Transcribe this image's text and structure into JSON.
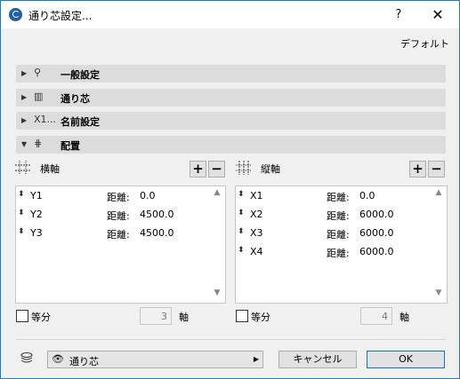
{
  "window": {
    "title": "通り芯設定...",
    "help": "?",
    "close": "✕"
  },
  "default_link": "デフォルト",
  "sections": [
    {
      "icon": "⚲",
      "label": "一般設定"
    },
    {
      "icon": "▥",
      "label": "通り芯"
    },
    {
      "icon": "X1...",
      "label": "名前設定"
    },
    {
      "icon": "⋕",
      "label": "配置"
    }
  ],
  "horizontal": {
    "label": "横軸",
    "rows": [
      {
        "name": "Y1",
        "label": "距離:",
        "value": "0.0"
      },
      {
        "name": "Y2",
        "label": "距離:",
        "value": "4500.0"
      },
      {
        "name": "Y3",
        "label": "距離:",
        "value": "4500.0"
      }
    ],
    "equal_label": "等分",
    "count": "3",
    "axis_label": "軸"
  },
  "vertical": {
    "label": "縦軸",
    "rows": [
      {
        "name": "X1",
        "label": "距離:",
        "value": "0.0"
      },
      {
        "name": "X2",
        "label": "距離:",
        "value": "6000.0"
      },
      {
        "name": "X3",
        "label": "距離:",
        "value": "6000.0"
      },
      {
        "name": "X4",
        "label": "距離:",
        "value": "6000.0"
      }
    ],
    "equal_label": "等分",
    "count": "4",
    "axis_label": "軸"
  },
  "plus": "+",
  "minus": "−",
  "layer": {
    "value": "通り芯"
  },
  "buttons": {
    "cancel": "キャンセル",
    "ok": "OK"
  }
}
